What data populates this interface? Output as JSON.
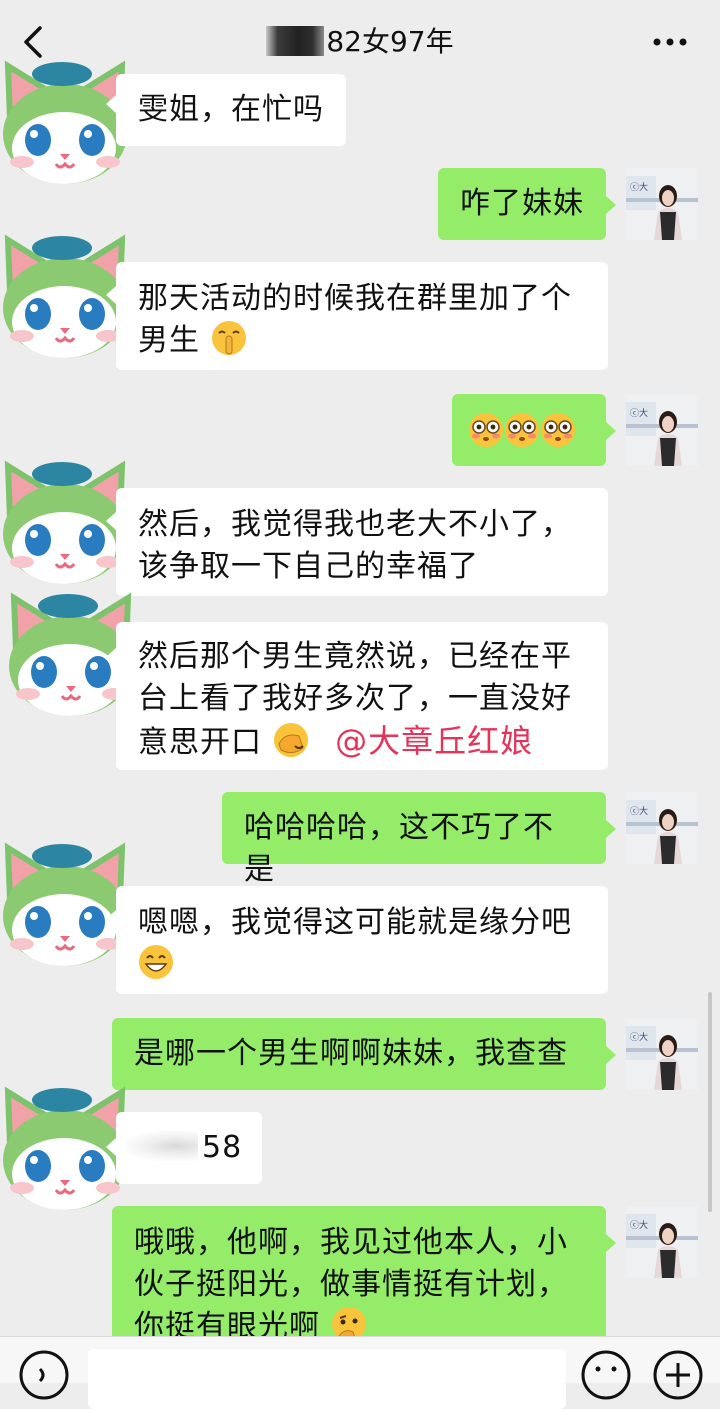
{
  "header": {
    "title": "82女97年"
  },
  "messages": [
    {
      "side": "left",
      "text": "雯姐，在忙吗"
    },
    {
      "side": "right",
      "text": "咋了妹妹"
    },
    {
      "side": "left",
      "text": "那天活动的时候我在群里加了个男生",
      "emoji": "shush-face"
    },
    {
      "side": "right",
      "text": "",
      "emoji": "flushed-face x3"
    },
    {
      "side": "left",
      "text": "然后，我觉得我也老大不小了，该争取一下自己的幸福了"
    },
    {
      "side": "left",
      "text": "然后那个男生竟然说，已经在平台上看了我好多次了，一直没好意思开口",
      "emoji": "facepalm",
      "mention": "@大章丘红娘"
    },
    {
      "side": "right",
      "text": "哈哈哈哈，这不巧了不是"
    },
    {
      "side": "left",
      "text": "嗯嗯，我觉得这可能就是缘分吧",
      "emoji": "grinning-face"
    },
    {
      "side": "right",
      "text": "是哪一个男生啊啊妹妹，我查查"
    },
    {
      "side": "left",
      "text": "58"
    },
    {
      "side": "right",
      "text": "哦哦，他啊，我见过他本人，小伙子挺阳光，做事情挺有计划，你挺有眼光啊",
      "emoji": "thinking-face"
    }
  ],
  "colors": {
    "background": "#ededed",
    "bubble_left": "#ffffff",
    "bubble_right": "#95ec69",
    "mention": "#e4345a"
  },
  "icons": [
    "back-arrow-icon",
    "more-icon",
    "voice-icon",
    "emoji-icon",
    "plus-icon"
  ]
}
